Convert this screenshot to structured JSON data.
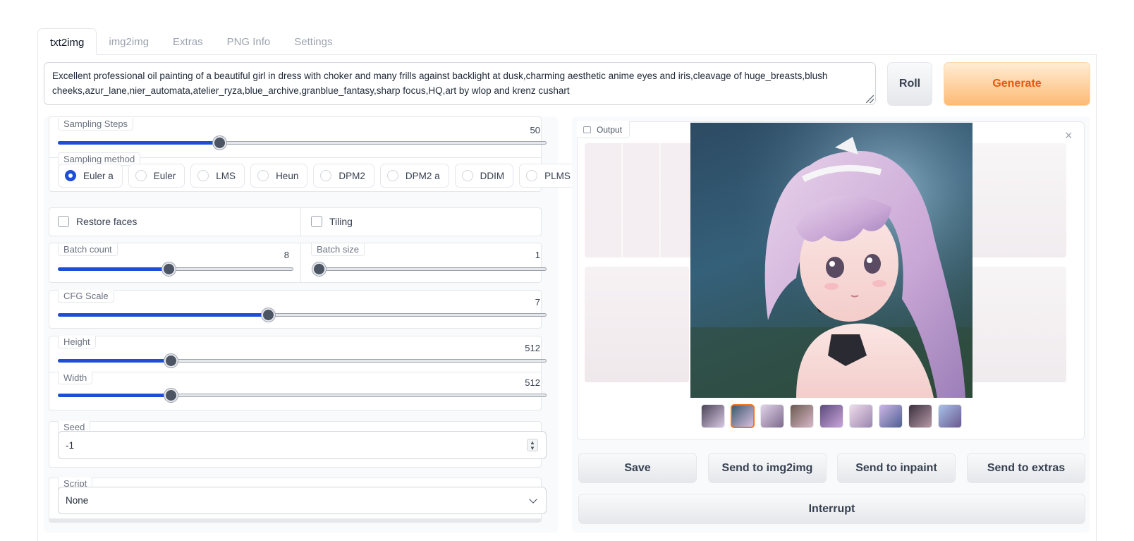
{
  "tabs": [
    "txt2img",
    "img2img",
    "Extras",
    "PNG Info",
    "Settings"
  ],
  "prompt": {
    "line1": "Excellent professional oil painting of a beautiful girl in dress with choker and many frills against backlight at dusk,charming aesthetic anime eyes and iris,cleavage of huge_breasts,blush",
    "line2": "cheeks,azur_lane,nier_automata,atelier_ryza,blue_archive,granblue_fantasy,sharp focus,HQ,art by wlop and krenz cushart"
  },
  "buttons": {
    "roll": "Roll",
    "generate": "Generate",
    "save": "Save",
    "send_img2img": "Send to img2img",
    "send_inpaint": "Send to inpaint",
    "send_extras": "Send to extras",
    "interrupt": "Interrupt"
  },
  "sampling_steps": {
    "label": "Sampling Steps",
    "value": "50",
    "fraction": 0.33
  },
  "sampling_method": {
    "label": "Sampling method",
    "options": [
      "Euler a",
      "Euler",
      "LMS",
      "Heun",
      "DPM2",
      "DPM2 a",
      "DDIM",
      "PLMS"
    ],
    "selected": "Euler a"
  },
  "checkboxes": {
    "restore_faces": "Restore faces",
    "tiling": "Tiling"
  },
  "batch_count": {
    "label": "Batch count",
    "value": "8",
    "fraction": 0.47
  },
  "batch_size": {
    "label": "Batch size",
    "value": "1",
    "fraction": 0.0
  },
  "cfg_scale": {
    "label": "CFG Scale",
    "value": "7",
    "fraction": 0.43
  },
  "height": {
    "label": "Height",
    "value": "512",
    "fraction": 0.23
  },
  "width": {
    "label": "Width",
    "value": "512",
    "fraction": 0.23
  },
  "seed": {
    "label": "Seed",
    "value": "-1"
  },
  "script": {
    "label": "Script",
    "value": "None"
  },
  "output": {
    "label": "Output",
    "close": "×",
    "thumbnail_count": 9,
    "selected_thumbnail": 2
  },
  "colors": {
    "accent": "#1d4ed8",
    "generate_text": "#ea580c",
    "generate_bg": "#fdba74",
    "thumb_selected": "#f97316"
  }
}
